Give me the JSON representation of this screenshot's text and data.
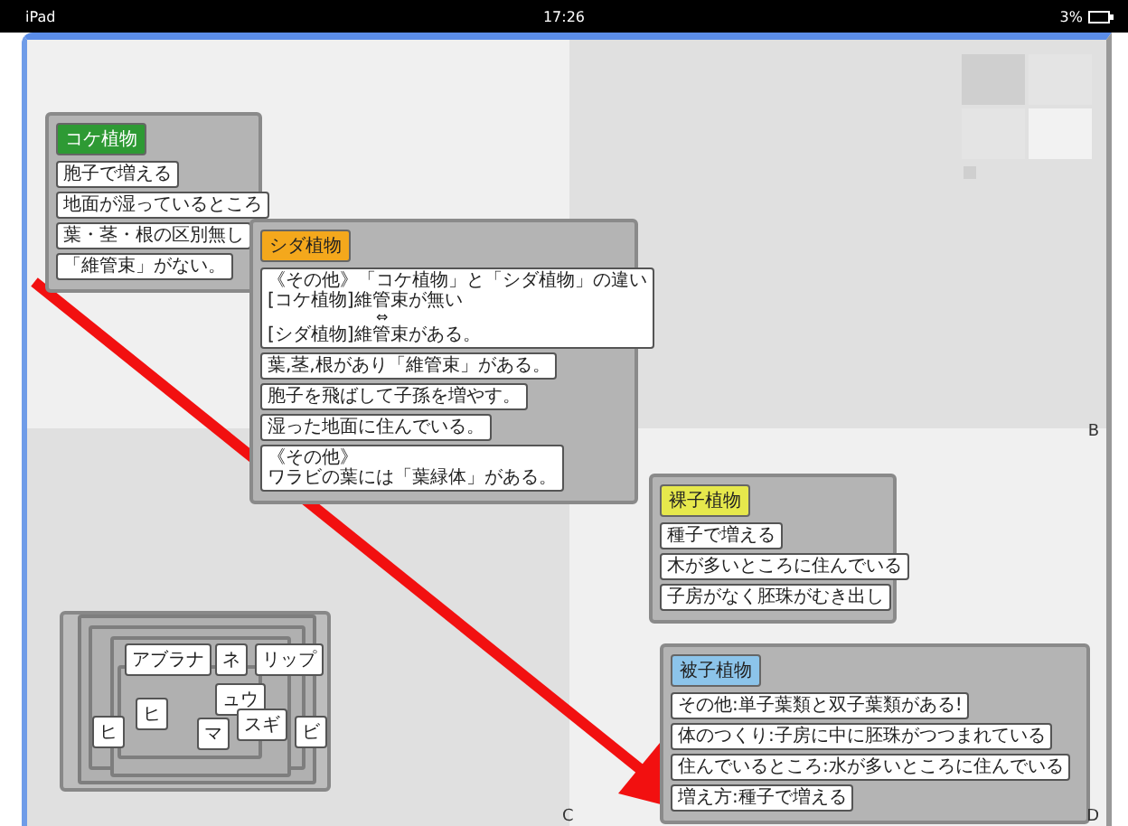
{
  "status_bar": {
    "device": "iPad",
    "time": "17:26",
    "battery": "3%"
  },
  "groups": [
    {
      "title": "コケ植物",
      "color": "#2e9a34",
      "items": [
        [
          "胞子で増える"
        ],
        [
          "地面が湿っているところ"
        ],
        [
          "葉・茎・根の区別無し"
        ],
        [
          "「維管束」がない。"
        ]
      ]
    },
    {
      "title": "シダ植物",
      "color": "#f4a81c",
      "items": [
        [
          "《その他》「コケ植物」と「シダ植物」の違い",
          "[コケ植物]維管束が無い",
          "⇔",
          "[シダ植物]維管束がある。"
        ],
        [
          "葉,茎,根があり「維管束」がある。"
        ],
        [
          "胞子を飛ばして子孫を増やす。"
        ],
        [
          "湿った地面に住んでいる。"
        ],
        [
          "《その他》",
          "ワラビの葉には「葉緑体」がある。"
        ]
      ]
    },
    {
      "title": "裸子植物",
      "color": "#e6e84c",
      "items": [
        [
          "種子で増える"
        ],
        [
          "木が多いところに住んでいる"
        ],
        [
          "子房がなく胚珠がむき出し"
        ]
      ]
    },
    {
      "title": "被子植物",
      "color": "#8cc4ea",
      "items": [
        [
          "その他:単子葉類と双子葉類がある!"
        ],
        [
          "体のつくり:子房に中に胚珠がつつまれている"
        ],
        [
          "住んでいるところ:水が多いところに住んでいる"
        ],
        [
          "増え方:種子で増える"
        ]
      ]
    }
  ],
  "pile": [
    "ヒ",
    "アブラナ",
    "ネ",
    "リップ",
    "ュウ",
    "ビ",
    "ヒ",
    "マ",
    "スギ"
  ],
  "quadrant_labels": [
    "B",
    "C",
    "D"
  ]
}
